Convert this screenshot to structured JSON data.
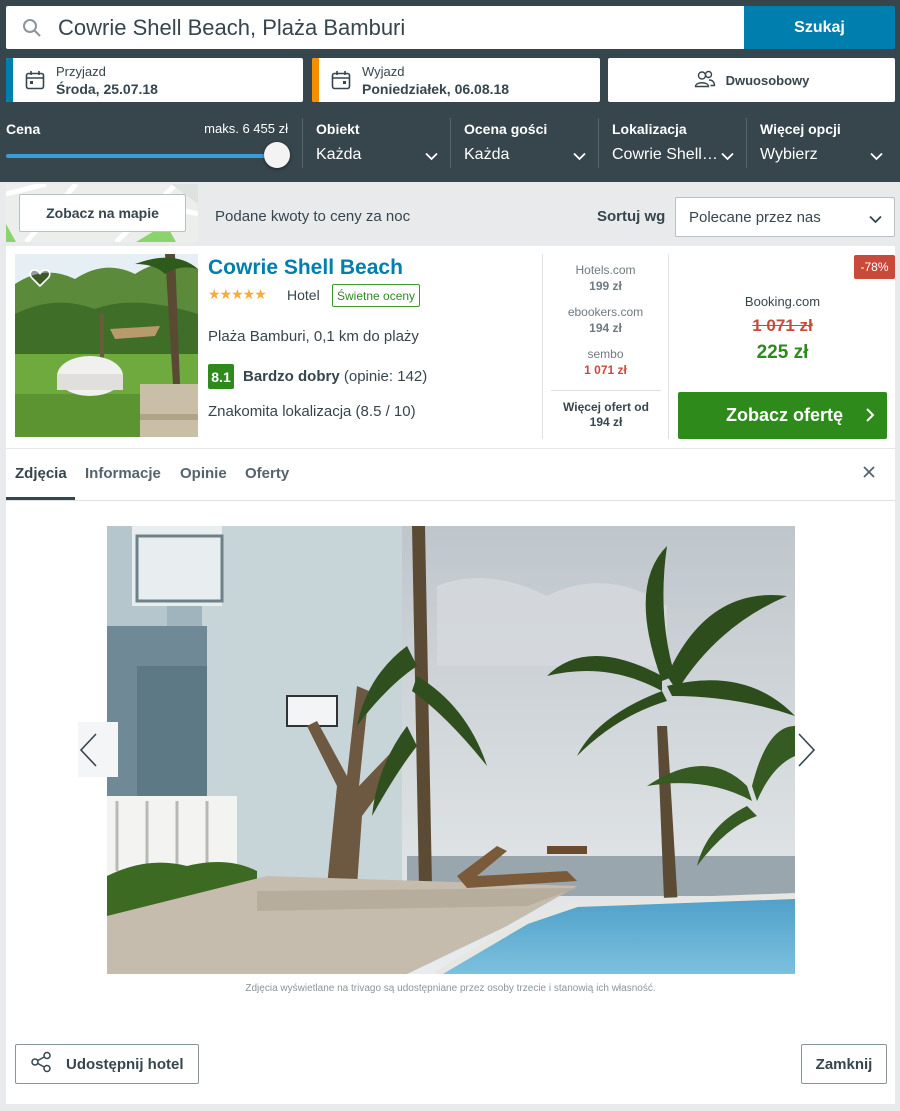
{
  "search": {
    "query": "Cowrie Shell Beach, Plaża Bamburi",
    "button_label": "Szukaj",
    "search_icon": "search-icon"
  },
  "dates": {
    "checkin_label": "Przyjazd",
    "checkin_value": "Środa, 25.07.18",
    "checkin_accent": "#007faf",
    "checkout_label": "Wyjazd",
    "checkout_value": "Poniedziałek, 06.08.18",
    "checkout_accent": "#f48f00"
  },
  "room": {
    "label": "Dwuosobowy",
    "icon": "people-icon"
  },
  "filters": {
    "price_label": "Cena",
    "price_max": "maks. 6 455 zł",
    "price_slider_fraction": 1.0,
    "property_label": "Obiekt",
    "property_value": "Każda",
    "guest_rating_label": "Ocena gości",
    "guest_rating_value": "Każda",
    "location_label": "Lokalizacja",
    "location_value": "Cowrie Shell…",
    "more_label": "Więcej opcji",
    "more_value": "Wybierz"
  },
  "toolbar": {
    "map_button": "Zobacz na mapie",
    "price_note": "Podane kwoty to ceny za noc",
    "sort_label": "Sortuj wg",
    "sort_value": "Polecane przez nas"
  },
  "hotel": {
    "name": "Cowrie Shell Beach",
    "stars": 5,
    "stars_text": "★★★★★",
    "type": "Hotel",
    "rating_badge": "Świetne oceny",
    "location": "Plaża Bamburi, 0,1 km do plaży",
    "score": "8.1",
    "score_label": "Bardzo dobry",
    "score_reviews": "(opinie: 142)",
    "location_score": "Znakomita lokalizacja (8.5 / 10)",
    "deals": [
      {
        "site": "Hotels.com",
        "price": "199 zł"
      },
      {
        "site": "ebookers.com",
        "price": "194 zł"
      },
      {
        "site": "sembo",
        "price": "1 071 zł"
      }
    ],
    "more_deals_line1": "Więcej ofert od",
    "more_deals_line2": "194 zł",
    "discount": "-78%",
    "best_site": "Booking.com",
    "old_price": "1 071 zł",
    "new_price": "225 zł",
    "deal_button": "Zobacz ofertę"
  },
  "tabs": [
    {
      "label": "Zdjęcia",
      "active": true
    },
    {
      "label": "Informacje",
      "active": false
    },
    {
      "label": "Opinie",
      "active": false
    },
    {
      "label": "Oferty",
      "active": false
    }
  ],
  "gallery": {
    "copyright": "Zdjęcia wyświetlane na trivago są udostępniane przez osoby trzecie i stanowią ich własność."
  },
  "footer": {
    "share_button": "Udostępnij hotel",
    "close_button": "Zamknij"
  },
  "colors": {
    "header_bg": "#37454d",
    "primary_blue": "#007faf",
    "deal_green": "#2d8a1b",
    "discount_red": "#c94a3b",
    "star_orange": "#f6ab3f"
  }
}
